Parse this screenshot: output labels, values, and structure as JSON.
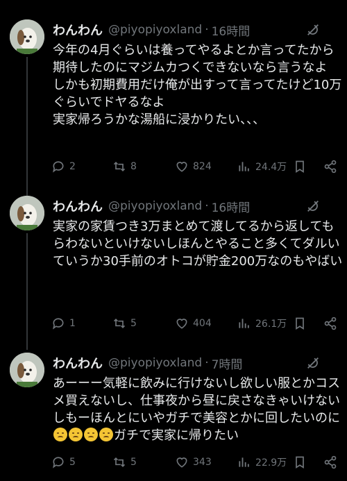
{
  "tweets": [
    {
      "name": "わんわん",
      "handle": "@piyopiyoxland",
      "separator": "·",
      "time": "16時間",
      "text": "今年の4月ぐらいは養ってやるよとか言ってたから期待したのにマジムカつくできないなら言うなよ\nしかも初期費用だけ俺が出すって言ってたけど10万ぐらいでドヤるなよ\n実家帰ろうかな湯船に浸かりたい、、、",
      "replies": "2",
      "reposts": "8",
      "likes": "824",
      "views": "24.4万"
    },
    {
      "name": "わんわん",
      "handle": "@piyopiyoxland",
      "separator": "·",
      "time": "16時間",
      "text": "実家の家賃つき3万まとめて渡してるから返してもらわないといけないしほんとやること多くてダルい\nていうか30手前のオトコが貯金200万なのもやばい",
      "replies": "1",
      "reposts": "5",
      "likes": "404",
      "views": "26.1万"
    },
    {
      "name": "わんわん",
      "handle": "@piyopiyoxland",
      "separator": "·",
      "time": "7時間",
      "text_before": "あーーー気軽に飲みに行けないし欲しい服とかコスメ買えないし、仕事夜から昼に戻さなきゃいけないしもーほんとにいやガチで美容とかに回したいのに",
      "text_after": "ガチで実家に帰りたい",
      "emoji_icon": "smiling-face-with-tear-emoji",
      "replies": "5",
      "reposts": "5",
      "likes": "343",
      "views": "22.9万"
    }
  ],
  "colors": {
    "background": "#000000",
    "text": "#e7e9ea",
    "muted": "#71767b",
    "thread_line": "#333639"
  }
}
